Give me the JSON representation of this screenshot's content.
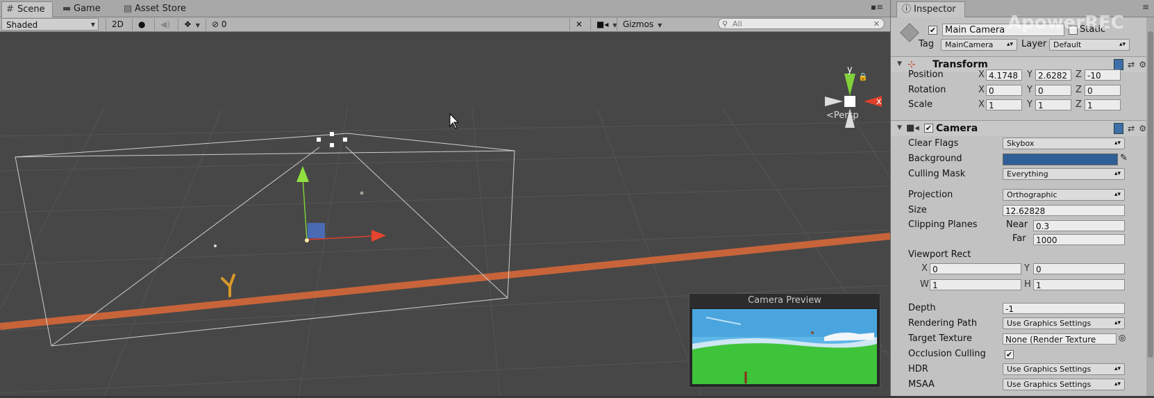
{
  "scene": {
    "tabs": [
      {
        "label": "Scene",
        "icon": "grid-icon"
      },
      {
        "label": "Game",
        "icon": "gamepad-icon"
      },
      {
        "label": "Asset Store",
        "icon": "bag-icon"
      }
    ],
    "toolbar": {
      "shading": "Shaded",
      "mode_2d": "2D",
      "hidden_count": "0",
      "gizmos": "Gizmos",
      "search_placeholder": "All"
    },
    "gizmo": {
      "y": "y",
      "x": "x",
      "projection": "Persp"
    },
    "camera_preview": {
      "title": "Camera Preview"
    }
  },
  "inspector": {
    "tab": "Inspector",
    "watermark": "ApowerREC",
    "object": {
      "active": true,
      "name": "Main Camera",
      "static_label": "Static",
      "tag_label": "Tag",
      "tag": "MainCamera",
      "layer_label": "Layer",
      "layer": "Default"
    },
    "transform": {
      "title": "Transform",
      "position": {
        "label": "Position",
        "x": "4.1748",
        "y": "2.6282",
        "z": "-10"
      },
      "rotation": {
        "label": "Rotation",
        "x": "0",
        "y": "0",
        "z": "0"
      },
      "scale": {
        "label": "Scale",
        "x": "1",
        "y": "1",
        "z": "1"
      }
    },
    "camera": {
      "title": "Camera",
      "enabled": true,
      "clear_flags": {
        "label": "Clear Flags",
        "value": "Skybox"
      },
      "background": {
        "label": "Background",
        "color": "#2f5f96"
      },
      "culling_mask": {
        "label": "Culling Mask",
        "value": "Everything"
      },
      "projection": {
        "label": "Projection",
        "value": "Orthographic"
      },
      "size": {
        "label": "Size",
        "value": "12.62828"
      },
      "clipping": {
        "label": "Clipping Planes",
        "near_label": "Near",
        "near": "0.3",
        "far_label": "Far",
        "far": "1000"
      },
      "viewport": {
        "label": "Viewport Rect",
        "x": "0",
        "y": "0",
        "w": "1",
        "h": "1"
      },
      "depth": {
        "label": "Depth",
        "value": "-1"
      },
      "rendering_path": {
        "label": "Rendering Path",
        "value": "Use Graphics Settings"
      },
      "target_texture": {
        "label": "Target Texture",
        "value": "None (Render Texture"
      },
      "occlusion": {
        "label": "Occlusion Culling",
        "checked": true
      },
      "hdr": {
        "label": "HDR",
        "value": "Use Graphics Settings"
      },
      "msaa": {
        "label": "MSAA",
        "value": "Use Graphics Settings"
      }
    }
  },
  "axis_labels": {
    "x": "X",
    "y": "Y",
    "z": "Z",
    "w": "W",
    "h": "H"
  }
}
